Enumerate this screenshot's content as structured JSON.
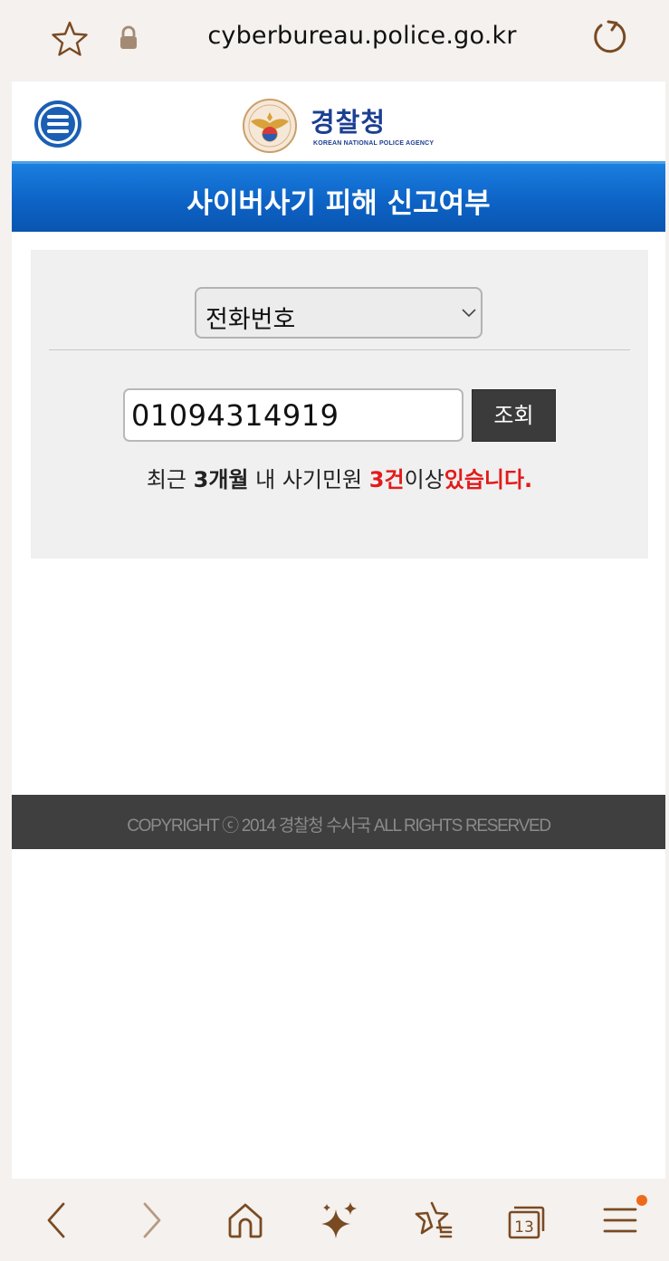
{
  "browser": {
    "url": "cyberbureau.police.go.kr",
    "tab_count": "13",
    "accent_color": "#7a4a22",
    "nav_icons": [
      "back-icon",
      "forward-icon",
      "home-icon",
      "sparkle-icon",
      "bookmarks-icon",
      "tabs-icon",
      "menu-icon"
    ]
  },
  "site": {
    "logo_kr": "경찰청",
    "logo_en": "KOREAN NATIONAL POLICE AGENCY",
    "banner_title": "사이버사기 피해 신고여부"
  },
  "form": {
    "search_type": "전화번호",
    "phone_value": "01094314919",
    "search_button": "조회"
  },
  "result": {
    "prefix": "최근 ",
    "period": "3개월",
    "middle": " 내 사기민원 ",
    "count": "3건",
    "suffix_plain": "이상",
    "suffix_emph": "있습니다."
  },
  "footer": {
    "copyright": "COPYRIGHT ⓒ 2014 경찰청 수사국 ALL RIGHTS RESERVED"
  }
}
